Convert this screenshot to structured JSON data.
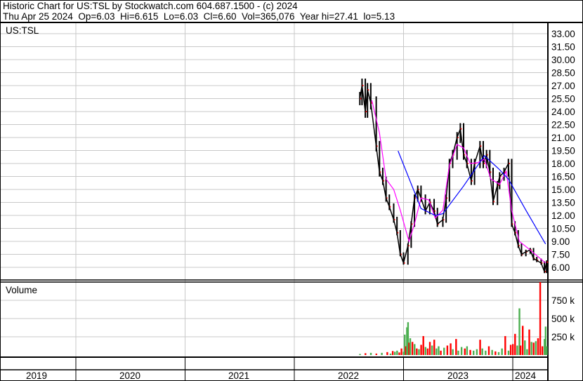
{
  "header": {
    "title": "Historic Chart for US:TSL by Stockwatch.com 604.687.1500 - (c) 2024",
    "quote": "Thu Apr 25 2024  Op=6.03  Hi=6.615  Lo=6.03  Cl=6.60  Vol=365,076  Year hi=27.41  lo=5.13"
  },
  "chart_data": {
    "type": "line",
    "symbol": "US:TSL",
    "volume_label": "Volume",
    "price_ticks": [
      "33.00",
      "31.50",
      "30.00",
      "28.50",
      "27.00",
      "25.50",
      "24.00",
      "22.50",
      "21.00",
      "19.50",
      "18.00",
      "16.50",
      "15.00",
      "13.50",
      "12.00",
      "10.50",
      "9.00",
      "7.50",
      "6.00"
    ],
    "price_ylim": [
      6,
      33
    ],
    "volume_ticks": [
      "750 k",
      "500 k",
      "250 k"
    ],
    "volume_tick_values": [
      750,
      500,
      250
    ],
    "x_labels": [
      "2019",
      "2020",
      "2021",
      "2022",
      "2023",
      "2024"
    ],
    "xlim": [
      2019.31,
      2024.32
    ],
    "colors": {
      "price": "#000000",
      "close": "#ff0000",
      "ma_short": "#ff00ff",
      "ma_long": "#0000ff",
      "vol_up": "#4caf50",
      "vol_down": "#ff0000",
      "grid": "#c8c8c8"
    },
    "price_series": {
      "x": [
        2022.6,
        2022.62,
        2022.65,
        2022.67,
        2022.7,
        2022.75,
        2022.78,
        2022.81,
        2022.84,
        2022.87,
        2022.91,
        2022.94,
        2022.97,
        2023.0,
        2023.04,
        2023.07,
        2023.1,
        2023.13,
        2023.16,
        2023.2,
        2023.24,
        2023.28,
        2023.31,
        2023.36,
        2023.39,
        2023.42,
        2023.45,
        2023.49,
        2023.52,
        2023.55,
        2023.58,
        2023.62,
        2023.65,
        2023.7,
        2023.73,
        2023.76,
        2023.79,
        2023.82,
        2023.86,
        2023.88,
        2023.92,
        2023.96,
        2023.99,
        2024.02,
        2024.05,
        2024.08,
        2024.12,
        2024.16,
        2024.19,
        2024.22,
        2024.26,
        2024.29,
        2024.31
      ],
      "close": [
        25.5,
        27,
        24,
        26.5,
        25,
        20,
        17,
        16,
        14,
        13,
        11.5,
        10,
        7.5,
        6.5,
        8.5,
        11,
        14,
        15,
        14,
        12.5,
        13.5,
        12.5,
        11,
        11.5,
        14,
        18,
        19,
        21,
        22,
        19,
        18,
        16,
        18,
        20,
        18,
        19,
        17,
        13.6,
        15.5,
        16.5,
        17,
        18,
        11,
        10,
        8.5,
        7.5,
        7.8,
        8,
        7,
        6.8,
        6.5,
        5.5,
        6.6
      ]
    },
    "ma_short": {
      "x": [
        2022.71,
        2022.78,
        2022.84,
        2022.91,
        2022.97,
        2023.05,
        2023.1,
        2023.16,
        2023.23,
        2023.29,
        2023.36,
        2023.42,
        2023.49,
        2023.55,
        2023.61,
        2023.68,
        2023.74,
        2023.8,
        2023.88,
        2023.94,
        2023.99,
        2024.06,
        2024.15,
        2024.3
      ],
      "y": [
        25.3,
        21.5,
        16.2,
        15,
        12.6,
        9,
        11,
        14,
        13.8,
        11.7,
        12.6,
        17.8,
        20.2,
        19.8,
        18,
        18.1,
        18.5,
        16.2,
        15.6,
        17.1,
        12.6,
        9,
        8.1,
        6.5
      ]
    },
    "ma_long": {
      "x": [
        2022.95,
        2023.16,
        2023.29,
        2023.36,
        2023.55,
        2023.74,
        2023.87,
        2023.96,
        2024.12,
        2024.3
      ],
      "y": [
        19.45,
        12.8,
        12,
        12.2,
        15.4,
        18.9,
        17.4,
        16.2,
        12.6,
        8.7
      ]
    },
    "volume_k": {
      "x": [
        2022.6,
        2022.65,
        2022.7,
        2022.75,
        2022.8,
        2022.85,
        2022.88,
        2022.9,
        2022.92,
        2022.94,
        2022.96,
        2022.98,
        2023.0,
        2023.01,
        2023.02,
        2023.03,
        2023.04,
        2023.05,
        2023.06,
        2023.08,
        2023.1,
        2023.12,
        2023.14,
        2023.16,
        2023.18,
        2023.2,
        2023.22,
        2023.24,
        2023.26,
        2023.28,
        2023.3,
        2023.32,
        2023.34,
        2023.37,
        2023.4,
        2023.43,
        2023.45,
        2023.48,
        2023.5,
        2023.53,
        2023.56,
        2023.58,
        2023.61,
        2023.64,
        2023.67,
        2023.7,
        2023.72,
        2023.75,
        2023.78,
        2023.81,
        2023.84,
        2023.87,
        2023.9,
        2023.93,
        2023.96,
        2023.98,
        2024.0,
        2024.02,
        2024.04,
        2024.06,
        2024.07,
        2024.09,
        2024.11,
        2024.13,
        2024.15,
        2024.17,
        2024.19,
        2024.21,
        2024.23,
        2024.25,
        2024.27,
        2024.29,
        2024.3,
        2024.31
      ],
      "v": [
        15,
        25,
        30,
        20,
        30,
        40,
        20,
        55,
        45,
        60,
        35,
        90,
        45,
        280,
        120,
        380,
        450,
        170,
        230,
        180,
        150,
        90,
        80,
        140,
        260,
        110,
        90,
        180,
        130,
        210,
        90,
        120,
        60,
        100,
        130,
        160,
        80,
        220,
        60,
        110,
        90,
        120,
        70,
        60,
        80,
        210,
        90,
        60,
        120,
        70,
        50,
        40,
        90,
        260,
        60,
        140,
        150,
        290,
        130,
        640,
        130,
        400,
        200,
        80,
        350,
        180,
        170,
        190,
        230,
        1000,
        120,
        220,
        390,
        120
      ],
      "up": [
        1,
        0,
        1,
        0,
        1,
        0,
        1,
        0,
        1,
        1,
        0,
        0,
        1,
        1,
        0,
        1,
        1,
        0,
        1,
        0,
        1,
        0,
        1,
        0,
        0,
        1,
        0,
        0,
        1,
        0,
        1,
        1,
        0,
        1,
        0,
        0,
        1,
        0,
        1,
        1,
        0,
        1,
        0,
        1,
        1,
        0,
        1,
        1,
        0,
        1,
        0,
        1,
        1,
        0,
        1,
        0,
        0,
        0,
        1,
        1,
        0,
        0,
        1,
        1,
        0,
        1,
        0,
        1,
        0,
        0,
        0,
        1,
        1,
        1
      ]
    }
  }
}
